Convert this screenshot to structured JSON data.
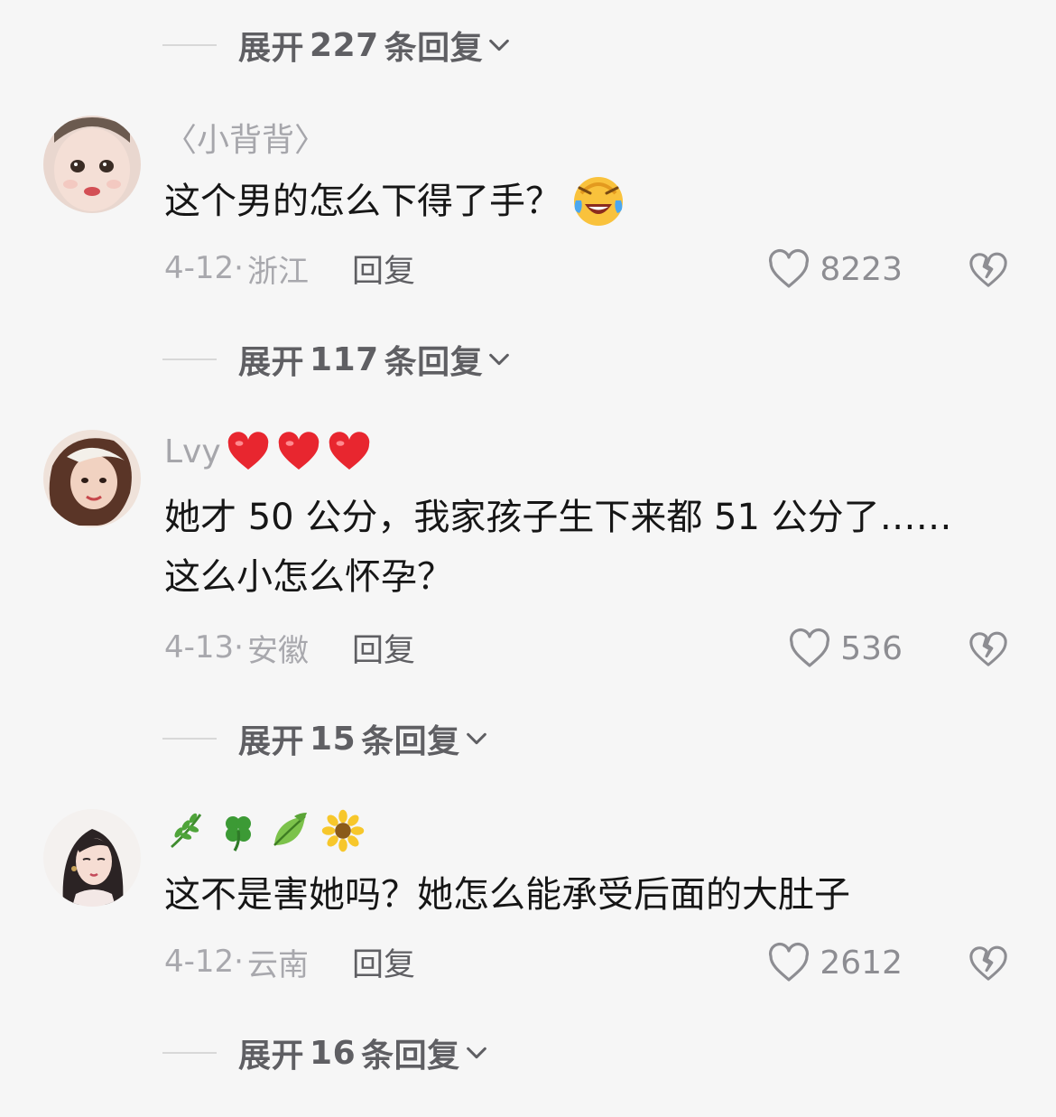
{
  "expands": [
    {
      "prefix": "展开",
      "count": "227",
      "suffix": "条回复"
    },
    {
      "prefix": "展开",
      "count": "117",
      "suffix": "条回复"
    },
    {
      "prefix": "展开",
      "count": "15",
      "suffix": "条回复"
    },
    {
      "prefix": "展开",
      "count": "16",
      "suffix": "条回复"
    }
  ],
  "comments": [
    {
      "username": "〈小背背〉",
      "text_lines": [
        "这个男的怎么下得了手？"
      ],
      "emoji": "laughing-crying-emoji",
      "date": "4-12·",
      "location": "浙江",
      "reply_label": "回复",
      "likes": "8223"
    },
    {
      "username": "Lvy",
      "username_icons": [
        "red-heart-icon",
        "red-heart-icon",
        "red-heart-icon"
      ],
      "text_lines": [
        "她才 50 公分，我家孩子生下来都 51 公分了……",
        "这么小怎么怀孕？"
      ],
      "date": "4-13·",
      "location": "安徽",
      "reply_label": "回复",
      "likes": "536"
    },
    {
      "username": "",
      "username_icons": [
        "herb-icon",
        "four-leaf-clover-icon",
        "leaf-icon",
        "sunflower-icon"
      ],
      "text_lines": [
        "这不是害她吗？她怎么能承受后面的大肚子"
      ],
      "date": "4-12·",
      "location": "云南",
      "reply_label": "回复",
      "likes": "2612"
    }
  ],
  "colors": {
    "background": "#f6f6f6",
    "text_primary": "#161616",
    "text_secondary": "#a8a8ad",
    "expand_text": "#5f5f63",
    "heart_red": "#e8262f"
  }
}
